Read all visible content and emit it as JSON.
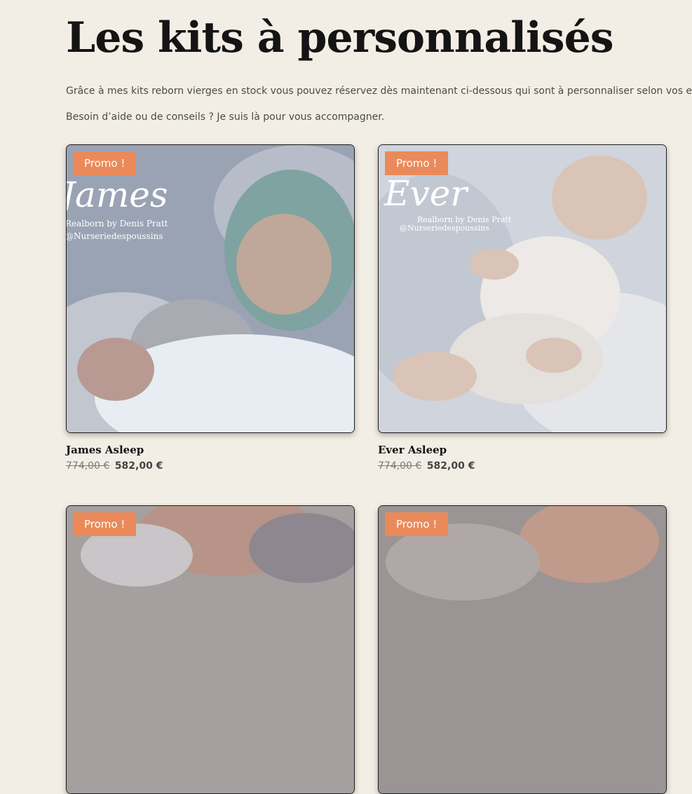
{
  "page": {
    "title": "Les kits à personnalisés",
    "intro": "Grâce à mes kits reborn vierges en stock vous pouvez réservez dès maintenant ci-dessous qui sont à personnaliser selon vos envi",
    "help": "Besoin d’aide ou de conseils ? Je suis là pour vous accompagner."
  },
  "products": [
    {
      "badge": "Promo !",
      "name": "James Asleep",
      "old_price": "774,00 €",
      "new_price": "582,00 €",
      "overlay_name": "James",
      "overlay_line1": "Realborn by Denis Pratt",
      "overlay_line2": "@Nurseriedespoussins"
    },
    {
      "badge": "Promo !",
      "name": "Ever Asleep",
      "old_price": "774,00 €",
      "new_price": "582,00 €",
      "overlay_name": "Ever",
      "overlay_line1": "Realborn by Denis Pratt",
      "overlay_line2": "@Nurseriedespoussins"
    },
    {
      "badge": "Promo !"
    },
    {
      "badge": "Promo !"
    }
  ],
  "colors": {
    "background": "#f2eee5",
    "badge": "#ea8a5a"
  }
}
